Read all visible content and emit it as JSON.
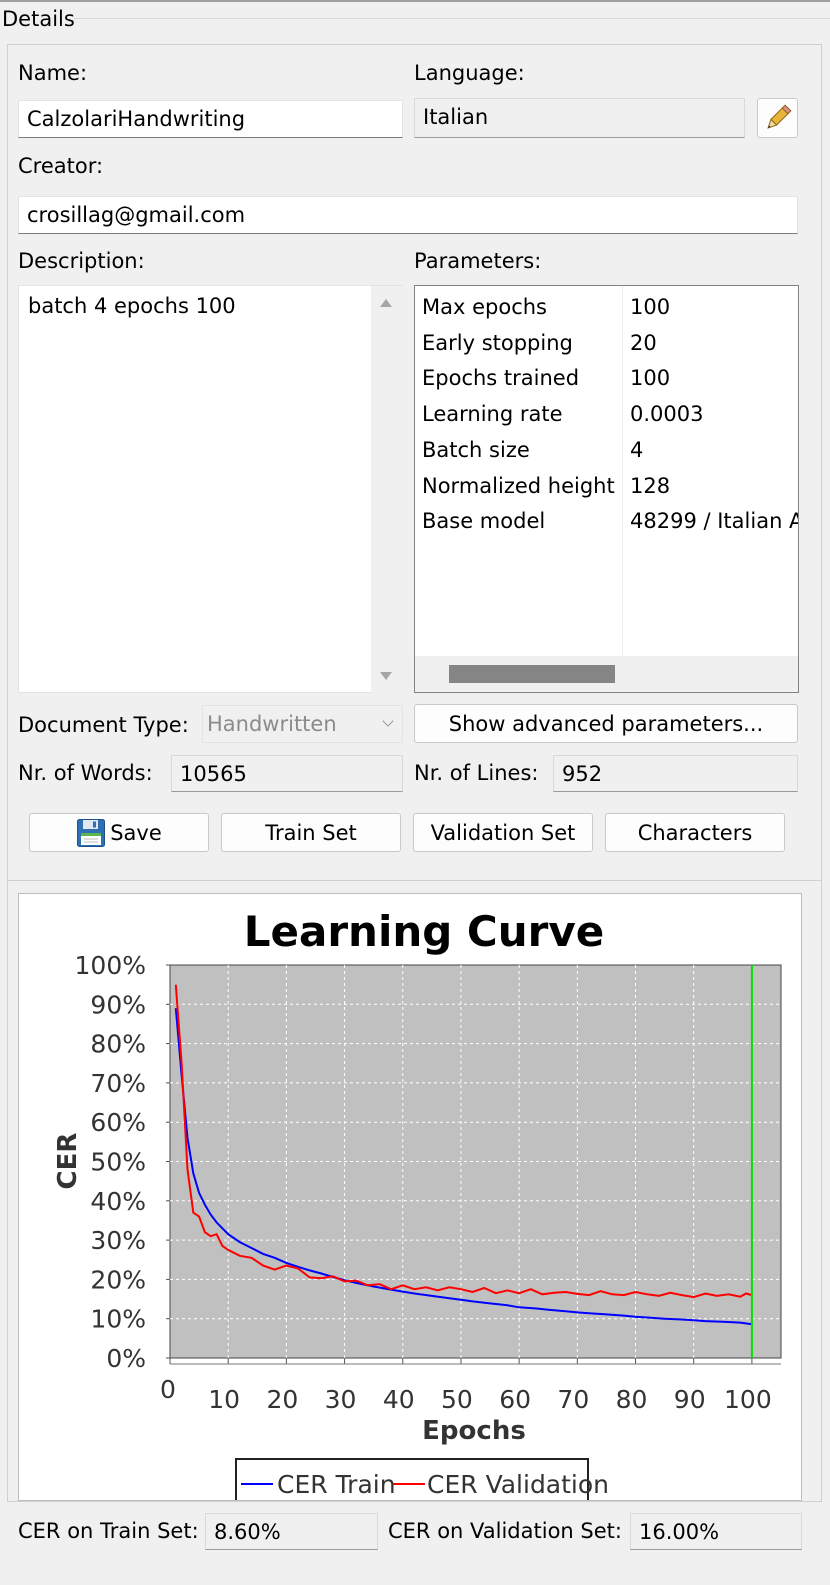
{
  "group": {
    "title": "Details"
  },
  "form": {
    "name_label": "Name:",
    "name_value": "CalzolariHandwriting",
    "language_label": "Language:",
    "language_value": "Italian",
    "creator_label": "Creator:",
    "creator_value": "crosillag@gmail.com",
    "description_label": "Description:",
    "description_value": "batch 4 epochs 100",
    "parameters_label": "Parameters:",
    "document_type_label": "Document Type:",
    "document_type_value": "Handwritten",
    "advanced_button": "Show advanced parameters...",
    "words_label": "Nr. of Words:",
    "words_value": "10565",
    "lines_label": "Nr. of Lines:",
    "lines_value": "952"
  },
  "parameters": [
    {
      "key": "Max epochs",
      "value": "100"
    },
    {
      "key": "Early stopping",
      "value": "20"
    },
    {
      "key": "Epochs trained",
      "value": "100"
    },
    {
      "key": "Learning rate",
      "value": "0.0003"
    },
    {
      "key": "Batch size",
      "value": "4"
    },
    {
      "key": "Normalized height",
      "value": "128"
    },
    {
      "key": "Base model",
      "value": "48299 / Italian A"
    }
  ],
  "buttons": {
    "save": "Save",
    "train_set": "Train Set",
    "validation_set": "Validation Set",
    "characters": "Characters"
  },
  "icons": {
    "edit": "pencil-icon",
    "save": "floppy-disk-icon"
  },
  "footer": {
    "cer_train_label": "CER on Train Set:",
    "cer_train_value": "8.60%",
    "cer_val_label": "CER on Validation Set:",
    "cer_val_value": "16.00%"
  },
  "colors": {
    "plot_background": "#c0c0c0",
    "train_series": "#0000ff",
    "validation_series": "#ff0000",
    "marker_line": "#00e000"
  },
  "chart_data": {
    "type": "line",
    "title": "Learning Curve",
    "xlabel": "Epochs",
    "ylabel": "CER",
    "xlim": [
      0,
      105
    ],
    "ylim": [
      0,
      100
    ],
    "x_ticks": [
      "0",
      "10",
      "20",
      "30",
      "40",
      "50",
      "60",
      "70",
      "80",
      "90",
      "100"
    ],
    "y_ticks": [
      "0%",
      "10%",
      "20%",
      "30%",
      "40%",
      "50%",
      "60%",
      "70%",
      "80%",
      "90%",
      "100%"
    ],
    "grid": true,
    "legend_position": "bottom",
    "vertical_marker_x": 100,
    "series": [
      {
        "name": "CER Train",
        "x": [
          1,
          2,
          3,
          4,
          5,
          6,
          7,
          8,
          9,
          10,
          12,
          14,
          16,
          18,
          20,
          22,
          24,
          26,
          28,
          30,
          32,
          35,
          38,
          40,
          42,
          45,
          48,
          50,
          52,
          55,
          58,
          60,
          63,
          65,
          68,
          70,
          72,
          75,
          78,
          80,
          82,
          85,
          88,
          90,
          92,
          95,
          98,
          100
        ],
        "values": [
          89,
          72,
          56,
          47,
          42,
          39,
          36.5,
          34.5,
          33,
          31.5,
          29.5,
          28,
          26.5,
          25.5,
          24.2,
          23.2,
          22.3,
          21.5,
          20.6,
          19.8,
          19.1,
          18.2,
          17.4,
          16.9,
          16.4,
          15.8,
          15.2,
          14.8,
          14.4,
          13.9,
          13.4,
          12.9,
          12.6,
          12.3,
          11.9,
          11.6,
          11.4,
          11.1,
          10.8,
          10.5,
          10.3,
          10.0,
          9.8,
          9.6,
          9.4,
          9.2,
          9.0,
          8.6
        ]
      },
      {
        "name": "CER Validation",
        "x": [
          1,
          2,
          3,
          4,
          5,
          6,
          7,
          8,
          9,
          10,
          12,
          14,
          16,
          18,
          20,
          22,
          24,
          26,
          28,
          30,
          32,
          34,
          36,
          38,
          40,
          42,
          44,
          46,
          48,
          50,
          52,
          54,
          56,
          58,
          60,
          62,
          64,
          66,
          68,
          70,
          72,
          74,
          76,
          78,
          80,
          82,
          84,
          86,
          88,
          90,
          92,
          94,
          96,
          98,
          99,
          100
        ],
        "values": [
          95,
          75,
          48,
          37,
          36,
          32,
          31,
          31.5,
          28.5,
          27.5,
          26,
          25.5,
          23.5,
          22.5,
          23.5,
          22.8,
          20.5,
          20.3,
          20.8,
          19.5,
          19.7,
          18.5,
          18.8,
          17.5,
          18.5,
          17.5,
          18.0,
          17.2,
          18.0,
          17.5,
          16.8,
          17.8,
          16.5,
          17.2,
          16.5,
          17.5,
          16.2,
          16.6,
          16.8,
          16.3,
          16.0,
          17.0,
          16.2,
          16.0,
          16.8,
          16.2,
          15.8,
          16.6,
          16.0,
          15.5,
          16.4,
          15.8,
          16.2,
          15.6,
          16.4,
          16.0
        ]
      }
    ]
  }
}
